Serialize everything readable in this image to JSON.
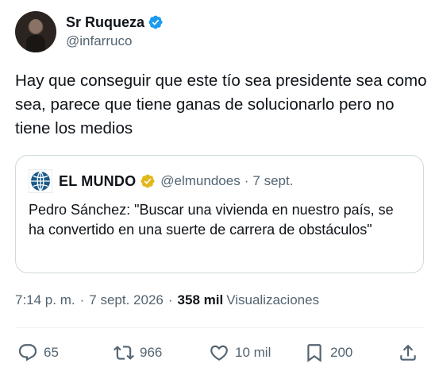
{
  "author": {
    "display_name": "Sr Ruqueza",
    "handle": "@infarruco",
    "verified_icon": "verified-badge-blue"
  },
  "tweet": {
    "text": "Hay que conseguir que este tío sea presidente sea como sea, parece que tiene ganas de solucionarlo pero no tiene los medios"
  },
  "quoted": {
    "name": "EL MUNDO",
    "handle": "@elmundoes",
    "separator": "·",
    "date": "7 sept.",
    "text": "Pedro Sánchez: \"Buscar una vivienda en nuestro país, se ha convertido en una suerte de carrera de obstáculos\"",
    "verified_icon": "verified-badge-gold"
  },
  "meta": {
    "time": "7:14 p. m.",
    "dot1": "·",
    "date": "7 sept. 2026",
    "dot2": "·",
    "views_count": "358 mil",
    "views_label": "Visualizaciones"
  },
  "actions": {
    "replies": "65",
    "retweets": "966",
    "likes": "10 mil",
    "bookmarks": "200"
  },
  "colors": {
    "text": "#0f1419",
    "secondary": "#536471",
    "border": "#cfd9de",
    "verified_blue": "#1d9bf0",
    "verified_gold": "#e2b719"
  }
}
